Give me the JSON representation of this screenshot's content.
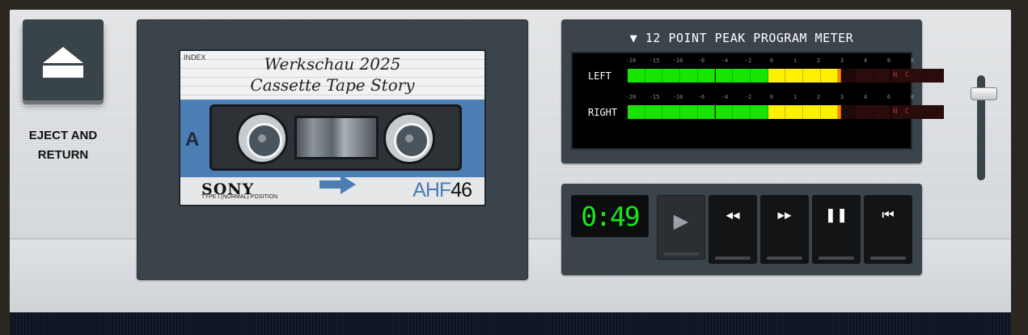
{
  "eject": {
    "label": "EJECT AND\nRETURN"
  },
  "cassette": {
    "index_label": "INDEX",
    "title_line1": "Werkschau 2025",
    "title_line2": "Cassette Tape Story",
    "side": "A",
    "brand": "SONY",
    "position_text": "TYPE I (NORMAL) POSITION",
    "model_prefix": "AHF",
    "model_number": "46",
    "colors": {
      "label_blue": "#4c7db3"
    }
  },
  "meter": {
    "title": "▼ 12 POINT PEAK PROGRAM METER",
    "ticks": [
      "-20",
      "-15",
      "-10",
      "-6",
      "-4",
      "-2",
      "0",
      "1",
      "2",
      "3",
      "4",
      "6",
      "8"
    ],
    "channels": [
      {
        "label": "LEFT",
        "level_segments": 13,
        "total_segments": 18
      },
      {
        "label": "RIGHT",
        "level_segments": 13,
        "total_segments": 18
      }
    ],
    "clip_labels": [
      "N",
      "C"
    ],
    "colors": {
      "green": "#18e400",
      "yellow": "#fff000",
      "peak": "#ff8800"
    }
  },
  "transport": {
    "counter": "0:49",
    "counter_color": "#19e61b",
    "buttons": [
      {
        "name": "play-button",
        "glyph": "▶",
        "icon": "play-icon"
      },
      {
        "name": "rewind-button",
        "glyph": "◂◂",
        "icon": "rewind-icon"
      },
      {
        "name": "fast-forward-button",
        "glyph": "▸▸",
        "icon": "fast-forward-icon"
      },
      {
        "name": "pause-button",
        "glyph": "❚❚",
        "icon": "pause-icon"
      },
      {
        "name": "skip-back-button",
        "glyph": "⏮",
        "icon": "skip-back-icon"
      }
    ]
  },
  "volume": {
    "level": 0.9
  }
}
